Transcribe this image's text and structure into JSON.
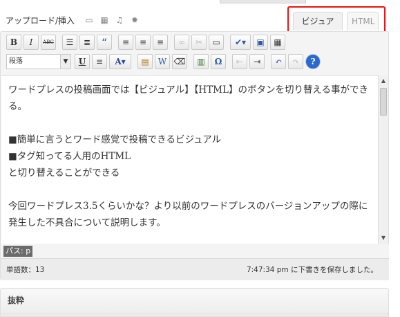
{
  "upload": {
    "label": "アップロード/挿入"
  },
  "upload_icons": [
    "image-icon",
    "video-icon",
    "music-icon",
    "media-icon"
  ],
  "tabs": {
    "visual": "ビジュアル",
    "html": "HTML"
  },
  "toolbar": {
    "row1": [
      {
        "name": "bold-button",
        "glyph": "B"
      },
      {
        "name": "italic-button",
        "glyph": "I"
      },
      {
        "name": "strikethrough-button",
        "glyph": "ABC"
      },
      {
        "name": "bullet-list-button",
        "glyph": "☰"
      },
      {
        "name": "numbered-list-button",
        "glyph": "≡"
      },
      {
        "name": "blockquote-button",
        "glyph": "“"
      },
      {
        "name": "align-left-button",
        "glyph": "≡"
      },
      {
        "name": "align-center-button",
        "glyph": "≡"
      },
      {
        "name": "align-right-button",
        "glyph": "≡"
      },
      {
        "name": "link-button",
        "glyph": "⛓"
      },
      {
        "name": "unlink-button",
        "glyph": "⛓"
      },
      {
        "name": "more-tag-button",
        "glyph": "▭"
      },
      {
        "name": "spellcheck-button",
        "glyph": "✔"
      },
      {
        "name": "fullscreen-button",
        "glyph": "▢"
      },
      {
        "name": "kitchen-sink-button",
        "glyph": "▦"
      }
    ],
    "format_select": "段落",
    "row2": [
      {
        "name": "underline-button",
        "glyph": "U"
      },
      {
        "name": "justify-button",
        "glyph": "≡"
      },
      {
        "name": "text-color-button",
        "glyph": "A"
      },
      {
        "name": "paste-text-button",
        "glyph": "T"
      },
      {
        "name": "paste-word-button",
        "glyph": "W"
      },
      {
        "name": "clear-formatting-button",
        "glyph": "⌫"
      },
      {
        "name": "insert-media-button",
        "glyph": "▤"
      },
      {
        "name": "special-char-button",
        "glyph": "Ω"
      },
      {
        "name": "outdent-button",
        "glyph": "⇤"
      },
      {
        "name": "indent-button",
        "glyph": "⇥"
      },
      {
        "name": "undo-button",
        "glyph": "↶"
      },
      {
        "name": "redo-button",
        "glyph": "↷"
      },
      {
        "name": "help-button",
        "glyph": "?"
      }
    ]
  },
  "content": {
    "line1": "ワードプレスの投稿画面では【ビジュアル】【HTML】のボタンを切り替える事ができる。",
    "line2": "■簡単に言うとワード感覚で投稿できるビジュアル",
    "line3": "■タグ知ってる人用のHTML",
    "line4": "と切り替えることができる",
    "line5": "今回ワードプレス3.5くらいかな？より以前のワードプレスのバージョンアップの際に発生した不具合について説明します。"
  },
  "path": "パス: p",
  "status": {
    "wordcount": "単語数：13",
    "saved": "7:47:34 pm に下書きを保存しました。"
  },
  "excerpt": {
    "title": "抜粋"
  },
  "colors": {
    "highlight": "#e11111",
    "toolbar_bg": "#f4f4f4"
  }
}
